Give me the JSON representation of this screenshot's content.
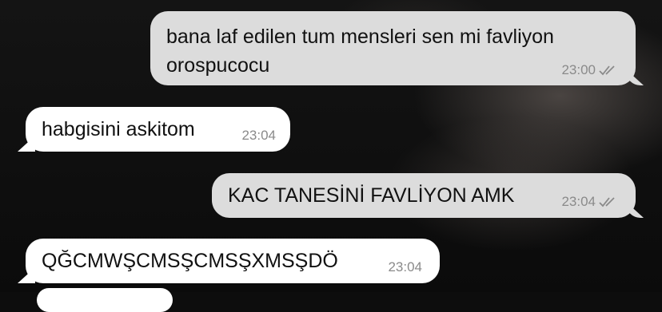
{
  "chat": {
    "messages": [
      {
        "direction": "outgoing",
        "text_line1": "bana laf edilen tum mensleri sen mi favliyon",
        "text_line2": "orospucocu",
        "time": "23:00",
        "status_icon": "double-check-icon"
      },
      {
        "direction": "incoming",
        "text": "habgisini askitom",
        "time": "23:04"
      },
      {
        "direction": "outgoing",
        "text": "KAC TANESİNİ FAVLİYON AMK",
        "time": "23:04",
        "status_icon": "double-check-icon"
      },
      {
        "direction": "incoming",
        "text": "QĞCMWŞCMSŞCMSŞXMSŞDÖ",
        "time": "23:04"
      }
    ]
  },
  "colors": {
    "outgoing_bubble": "#dcdcdc",
    "incoming_bubble": "#ffffff",
    "time": "#8a8a8a"
  }
}
